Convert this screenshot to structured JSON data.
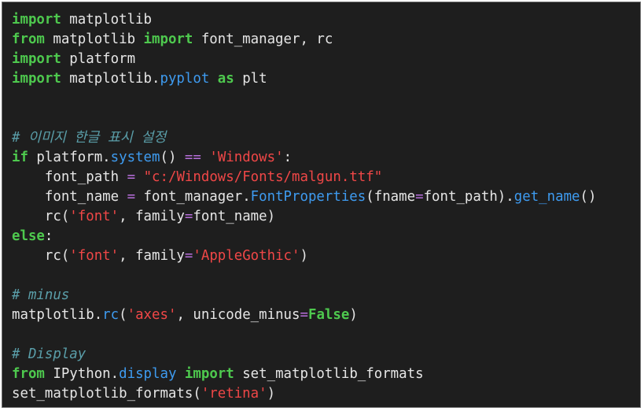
{
  "lines": [
    [
      {
        "t": "kw",
        "v": "import"
      },
      {
        "t": "tx",
        "v": " matplotlib"
      }
    ],
    [
      {
        "t": "kw",
        "v": "from"
      },
      {
        "t": "tx",
        "v": " matplotlib "
      },
      {
        "t": "kw",
        "v": "import"
      },
      {
        "t": "tx",
        "v": " font_manager, rc"
      }
    ],
    [
      {
        "t": "kw",
        "v": "import"
      },
      {
        "t": "tx",
        "v": " platform"
      }
    ],
    [
      {
        "t": "kw",
        "v": "import"
      },
      {
        "t": "tx",
        "v": " matplotlib."
      },
      {
        "t": "fn",
        "v": "pyplot"
      },
      {
        "t": "tx",
        "v": " "
      },
      {
        "t": "kw",
        "v": "as"
      },
      {
        "t": "tx",
        "v": " plt"
      }
    ],
    [],
    [],
    [
      {
        "t": "cmt",
        "v": "# 이미지 한글 표시 설정"
      }
    ],
    [
      {
        "t": "kw",
        "v": "if"
      },
      {
        "t": "tx",
        "v": " platform."
      },
      {
        "t": "fn",
        "v": "system"
      },
      {
        "t": "tx",
        "v": "() "
      },
      {
        "t": "op",
        "v": "=="
      },
      {
        "t": "tx",
        "v": " "
      },
      {
        "t": "str",
        "v": "'Windows'"
      },
      {
        "t": "tx",
        "v": ":"
      }
    ],
    [
      {
        "t": "tx",
        "v": "    font_path "
      },
      {
        "t": "op",
        "v": "="
      },
      {
        "t": "tx",
        "v": " "
      },
      {
        "t": "str",
        "v": "\"c:/Windows/Fonts/malgun.ttf\""
      }
    ],
    [
      {
        "t": "tx",
        "v": "    font_name "
      },
      {
        "t": "op",
        "v": "="
      },
      {
        "t": "tx",
        "v": " font_manager."
      },
      {
        "t": "fn",
        "v": "FontProperties"
      },
      {
        "t": "tx",
        "v": "(fname"
      },
      {
        "t": "op",
        "v": "="
      },
      {
        "t": "tx",
        "v": "font_path)."
      },
      {
        "t": "fn",
        "v": "get_name"
      },
      {
        "t": "tx",
        "v": "()"
      }
    ],
    [
      {
        "t": "tx",
        "v": "    rc("
      },
      {
        "t": "str",
        "v": "'font'"
      },
      {
        "t": "tx",
        "v": ", family"
      },
      {
        "t": "op",
        "v": "="
      },
      {
        "t": "tx",
        "v": "font_name)"
      }
    ],
    [
      {
        "t": "kw",
        "v": "else"
      },
      {
        "t": "tx",
        "v": ":"
      }
    ],
    [
      {
        "t": "tx",
        "v": "    rc("
      },
      {
        "t": "str",
        "v": "'font'"
      },
      {
        "t": "tx",
        "v": ", family"
      },
      {
        "t": "op",
        "v": "="
      },
      {
        "t": "str",
        "v": "'AppleGothic'"
      },
      {
        "t": "tx",
        "v": ")"
      }
    ],
    [],
    [
      {
        "t": "cmt",
        "v": "# minus"
      }
    ],
    [
      {
        "t": "tx",
        "v": "matplotlib."
      },
      {
        "t": "fn",
        "v": "rc"
      },
      {
        "t": "tx",
        "v": "("
      },
      {
        "t": "str",
        "v": "'axes'"
      },
      {
        "t": "tx",
        "v": ", unicode_minus"
      },
      {
        "t": "op",
        "v": "="
      },
      {
        "t": "kw",
        "v": "False"
      },
      {
        "t": "tx",
        "v": ")"
      }
    ],
    [],
    [
      {
        "t": "cmt",
        "v": "# Display"
      }
    ],
    [
      {
        "t": "kw",
        "v": "from"
      },
      {
        "t": "tx",
        "v": " IPython."
      },
      {
        "t": "fn",
        "v": "display"
      },
      {
        "t": "tx",
        "v": " "
      },
      {
        "t": "kw",
        "v": "import"
      },
      {
        "t": "tx",
        "v": " set_matplotlib_formats"
      }
    ],
    [
      {
        "t": "tx",
        "v": "set_matplotlib_formats("
      },
      {
        "t": "str",
        "v": "'retina'"
      },
      {
        "t": "tx",
        "v": ")"
      }
    ]
  ],
  "colors": {
    "background": "#1e1e1e",
    "keyword": "#4ec94e",
    "function": "#3e9bf0",
    "operator": "#b86fdc",
    "string": "#f04747",
    "comment": "#5a9ea9",
    "text": "#e6e6e6"
  }
}
